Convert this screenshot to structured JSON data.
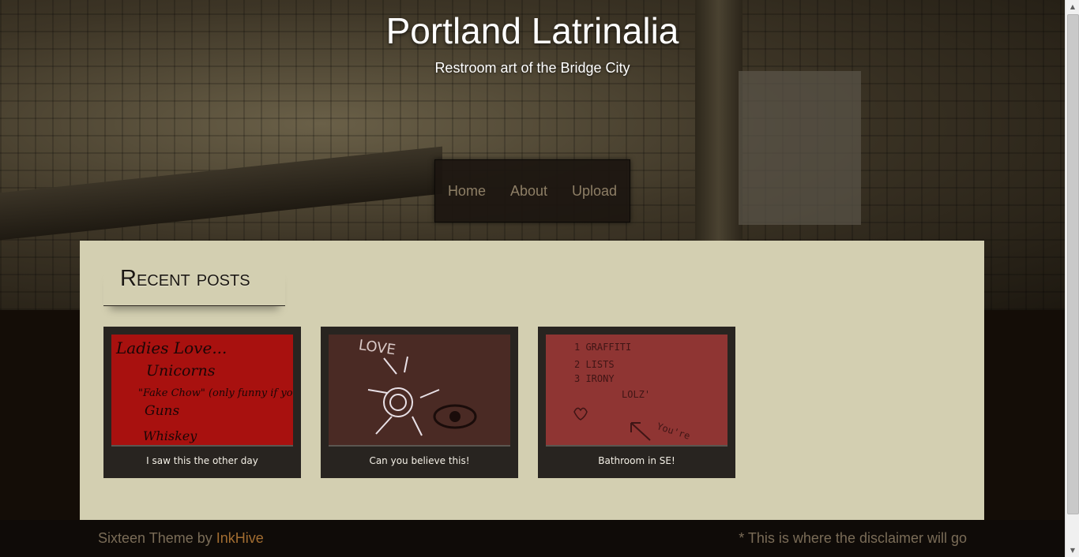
{
  "site": {
    "title": "Portland Latrinalia",
    "tagline": "Restroom art of the Bridge City"
  },
  "nav": {
    "items": [
      {
        "label": "Home"
      },
      {
        "label": "About"
      },
      {
        "label": "Upload"
      }
    ]
  },
  "main": {
    "section_title": "Recent posts",
    "posts": [
      {
        "caption": "I saw this the other day",
        "thumb_text": [
          "Ladies Love...",
          "Unicorns",
          "\"Fake Chow\" (only funny if you...",
          "Guns",
          "Whiskey"
        ],
        "thumb_color": "#a8110f"
      },
      {
        "caption": "Can you believe this!",
        "thumb_text": [
          "LOVE"
        ],
        "thumb_color": "#4a2a24"
      },
      {
        "caption": "Bathroom in SE!",
        "thumb_text": [
          "1 GRAFFITI",
          "2 LISTS",
          "3 IRONY",
          "LOLZ'",
          "You're"
        ],
        "thumb_color": "#8f3533"
      }
    ]
  },
  "footer": {
    "credit_prefix": "Sixteen Theme by ",
    "credit_link": "InkHive",
    "disclaimer": "* This is where the disclaimer will go"
  },
  "colors": {
    "content_bg": "#d3cfb1",
    "card_bg": "#282420",
    "nav_text": "#8e7f66",
    "footer_link": "#a26d31"
  }
}
